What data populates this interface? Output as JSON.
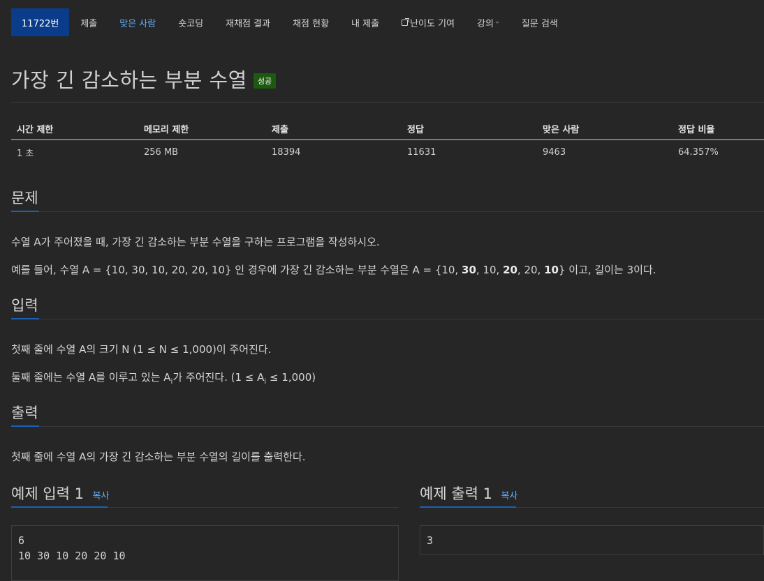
{
  "nav": {
    "items": [
      {
        "label": "11722번"
      },
      {
        "label": "제출"
      },
      {
        "label": "맞은 사람"
      },
      {
        "label": "숏코딩"
      },
      {
        "label": "재채점 결과"
      },
      {
        "label": "채점 현황"
      },
      {
        "label": "내 제출"
      },
      {
        "label": "난이도 기여"
      },
      {
        "label": "강의"
      },
      {
        "label": "질문 검색"
      }
    ]
  },
  "problem": {
    "title": "가장 긴 감소하는 부분 수열",
    "status_badge": "성공"
  },
  "info_table": {
    "headers": [
      "시간 제한",
      "메모리 제한",
      "제출",
      "정답",
      "맞은 사람",
      "정답 비율"
    ],
    "values": [
      "1 초",
      "256 MB",
      "18394",
      "11631",
      "9463",
      "64.357%"
    ]
  },
  "sections": {
    "description": {
      "title": "문제",
      "p1": "수열 A가 주어졌을 때, 가장 긴 감소하는 부분 수열을 구하는 프로그램을 작성하시오.",
      "p2_prefix": "예를 들어, 수열 A = {10, 30, 10, 20, 20, 10} 인 경우에 가장 긴 감소하는 부분 수열은 A = {10, ",
      "p2_b1": "30",
      "p2_m1": ", 10, ",
      "p2_b2": "20",
      "p2_m2": ", 20, ",
      "p2_b3": "10",
      "p2_suffix": "}  이고, 길이는 3이다."
    },
    "input": {
      "title": "입력",
      "p1": "첫째 줄에 수열 A의 크기 N (1 ≤ N ≤ 1,000)이 주어진다.",
      "p2_prefix": "둘째 줄에는 수열 A를 이루고 있는 A",
      "p2_sub": "i",
      "p2_mid": "가 주어진다. (1 ≤ A",
      "p2_sub2": "i",
      "p2_suffix": " ≤ 1,000)"
    },
    "output": {
      "title": "출력",
      "p1": "첫째 줄에 수열 A의 가장 긴 감소하는 부분 수열의 길이를 출력한다."
    }
  },
  "samples": {
    "input_title": "예제 입력 1",
    "output_title": "예제 출력 1",
    "copy_label": "복사",
    "input_text": "6\n10 30 10 20 20 10",
    "output_text": "3"
  }
}
